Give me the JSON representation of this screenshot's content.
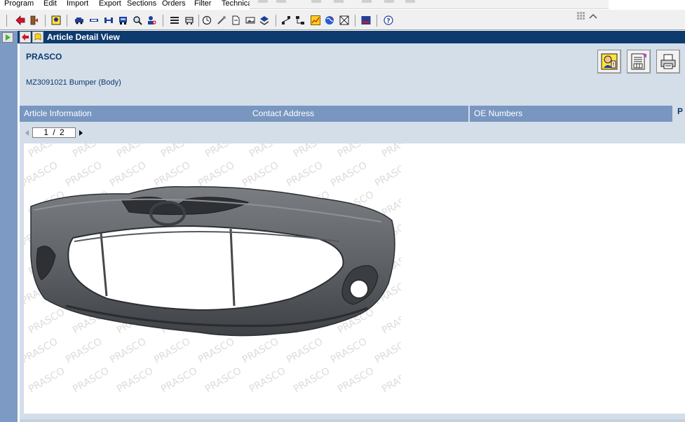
{
  "menu": {
    "items": [
      "Program",
      "Edit",
      "Import",
      "Export",
      "Sections",
      "Orders",
      "Filter",
      "Technica"
    ]
  },
  "colors": {
    "titlebar": "#0e3b6e",
    "panel": "#d3dee9",
    "tab": "#7896c0",
    "leftstrip": "#7d9ac4",
    "brand": "#0e3b6e"
  },
  "toolbar": {
    "icons": [
      "red-arrow-icon",
      "exit-door-icon",
      "user-badge-icon",
      "car-icon",
      "truck-icon",
      "axle-icon",
      "vehicle-search-icon",
      "magnifier-icon",
      "person-search-icon",
      "list-icon",
      "cart-icon",
      "clock-icon",
      "tools-icon",
      "document-icon",
      "image-icon",
      "stack-icon",
      "tree-icon",
      "network-icon",
      "chart-icon",
      "globe-icon",
      "grid-icon",
      "news-icon",
      "help-icon"
    ]
  },
  "window": {
    "title": "Article Detail View",
    "back_icon": "back-arrow-icon",
    "bookmark_icon": "bookmark-icon"
  },
  "header": {
    "brand": "PRASCO",
    "article": "MZ3091021 Bumper (Body)",
    "buttons": [
      "info-person-icon",
      "parts-list-icon",
      "printer-icon"
    ]
  },
  "tabs": [
    {
      "label": "Article Information"
    },
    {
      "label": "Contact Address"
    },
    {
      "label": "OE Numbers"
    }
  ],
  "tab_overflow": "P",
  "pager": {
    "current": "1",
    "separator": "/",
    "total": "2",
    "text": "1 / 2"
  },
  "image": {
    "watermark": "PRASCO"
  }
}
